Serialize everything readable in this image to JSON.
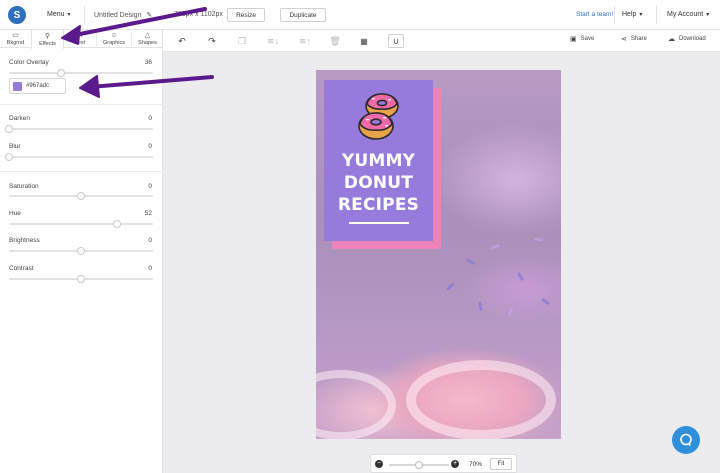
{
  "app": {
    "logo_letter": "S"
  },
  "topbar": {
    "menu_label": "Menu",
    "design_title": "Untitled Design",
    "dimensions": "735px x 1102px",
    "resize_label": "Resize",
    "duplicate_label": "Duplicate",
    "start_team_label": "Start a team!",
    "help_label": "Help",
    "account_label": "My Account"
  },
  "toolbar": {
    "save_label": "Save",
    "share_label": "Share",
    "download_label": "Download"
  },
  "tabs": [
    {
      "label": "Bkgrnd",
      "icon": "image-icon"
    },
    {
      "label": "Effects",
      "icon": "wand-icon",
      "active": true
    },
    {
      "label": "Text",
      "icon": "text-icon"
    },
    {
      "label": "Graphics",
      "icon": "smiley-icon"
    },
    {
      "label": "Shapes",
      "icon": "triangle-icon"
    }
  ],
  "effects": {
    "color_overlay": {
      "label": "Color Overlay",
      "value": "36",
      "level": 0.36,
      "hex": "#967adc"
    },
    "darken": {
      "label": "Darken",
      "value": "0",
      "level": 0.0
    },
    "blur": {
      "label": "Blur",
      "value": "0",
      "level": 0.0
    },
    "saturation": {
      "label": "Saturation",
      "value": "0",
      "level": 0.5
    },
    "hue": {
      "label": "Hue",
      "value": "52",
      "level": 0.75
    },
    "brightness": {
      "label": "Brightness",
      "value": "0",
      "level": 0.5
    },
    "contrast": {
      "label": "Contrast",
      "value": "0",
      "level": 0.5
    }
  },
  "design": {
    "headline_line1": "YUMMY",
    "headline_line2": "DONUT",
    "headline_line3": "RECIPES",
    "card_color": "#967adc",
    "shadow_color": "#ee83b9"
  },
  "zoom": {
    "value": "70%",
    "level": 0.5,
    "fit_label": "Fit"
  },
  "colors": {
    "accent": "#2f6fbf",
    "arrow": "#5b1a8c"
  }
}
